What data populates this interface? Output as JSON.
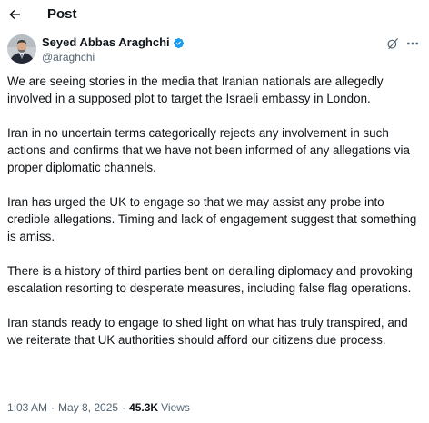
{
  "header": {
    "title": "Post"
  },
  "author": {
    "display_name": "Seyed Abbas Araghchi",
    "handle": "@araghchi",
    "verified": true,
    "verified_color": "#1d9bf0"
  },
  "tweet": {
    "paragraphs": [
      "We are seeing stories in the media that Iranian nationals are allegedly involved in a supposed plot to target the Israeli embassy in London.",
      "Iran in no uncertain terms categorically rejects any involvement in such actions and confirms that we have not been informed of any allegations via proper diplomatic channels.",
      "Iran has urged the UK to engage so that we may assist any probe into credible allegations. Timing and lack of engagement suggest that something is amiss.",
      "There is a history of third parties bent on derailing diplomacy and provoking escalation resorting to desperate measures, including false flag operations.",
      "Iran stands ready to engage to shed light on what has truly transpired, and we reiterate that UK authorities should afford our citizens due process."
    ]
  },
  "meta": {
    "time": "1:03 AM",
    "separator": "·",
    "date": "May 8, 2025",
    "views_count": "45.3K",
    "views_label": "Views"
  },
  "icons": {
    "back": "arrow-left-icon",
    "verified": "verified-badge-icon",
    "grok": "grok-icon",
    "more": "more-horizontal-icon"
  }
}
